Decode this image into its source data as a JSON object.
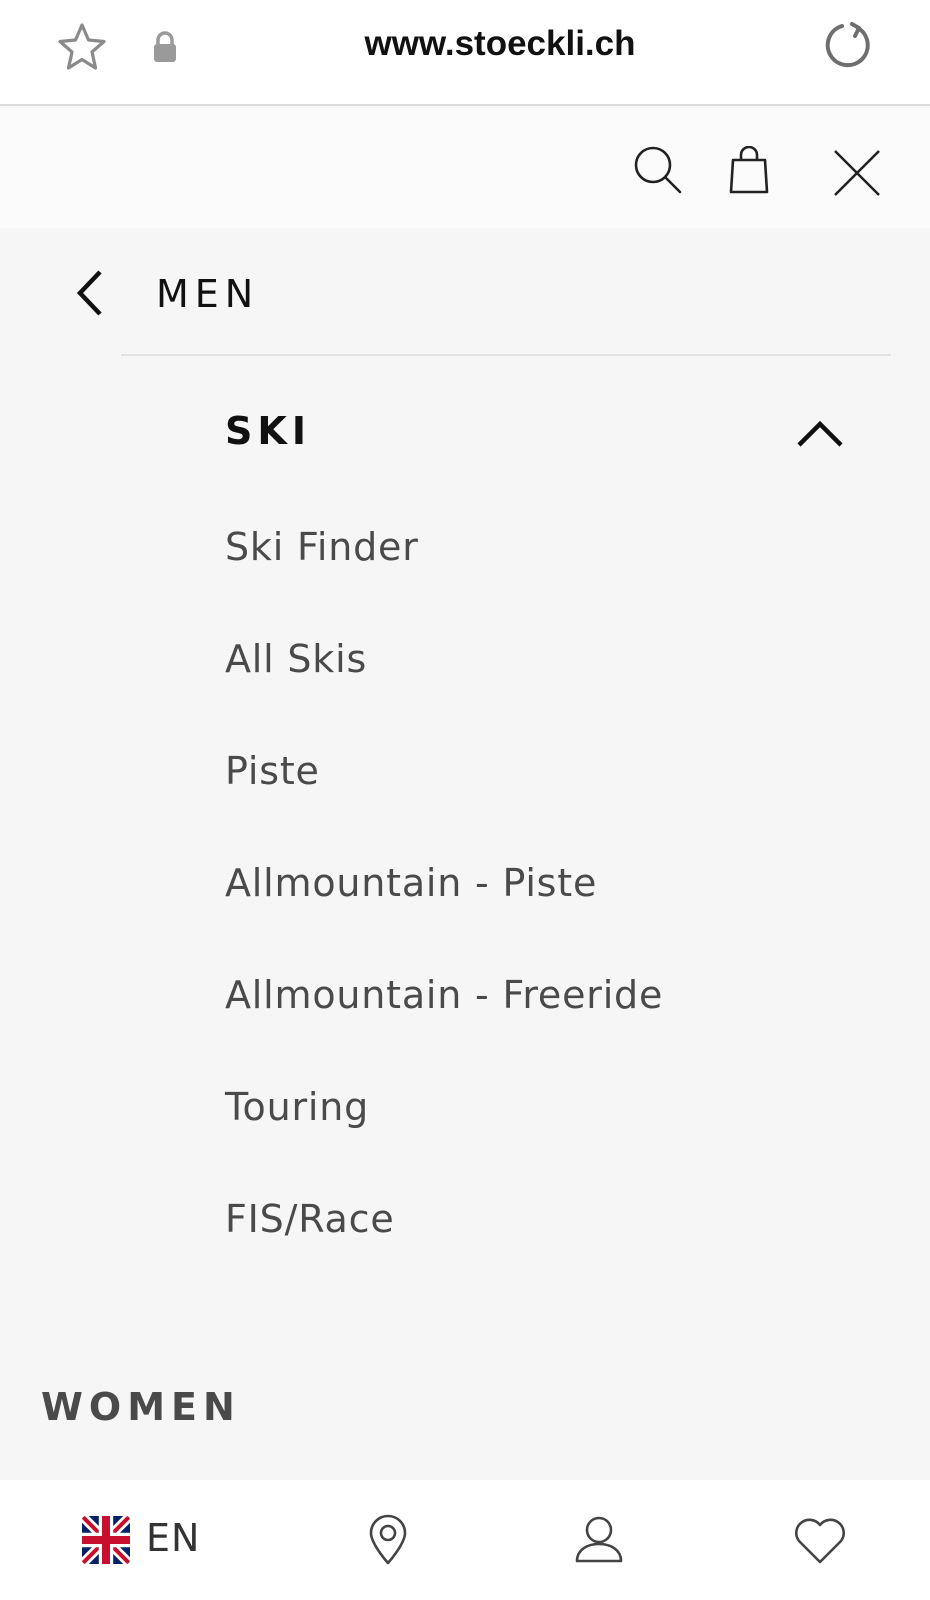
{
  "browser": {
    "url": "www.stoeckli.ch"
  },
  "menu": {
    "title": "MEN",
    "section": {
      "label": "SKI",
      "expanded": true,
      "items": [
        "Ski Finder",
        "All Skis",
        "Piste",
        "Allmountain - Piste",
        "Allmountain - Freeride",
        "Touring",
        "FIS/Race"
      ]
    },
    "next_section": "WOMEN"
  },
  "bottom_bar": {
    "language": "EN"
  },
  "icons": [
    "star-icon",
    "lock-icon",
    "reload-icon",
    "search-icon",
    "shopping-bag-icon",
    "close-icon",
    "back-arrow-icon",
    "chevron-up-icon",
    "uk-flag-icon",
    "location-pin-icon",
    "user-icon",
    "heart-icon"
  ]
}
